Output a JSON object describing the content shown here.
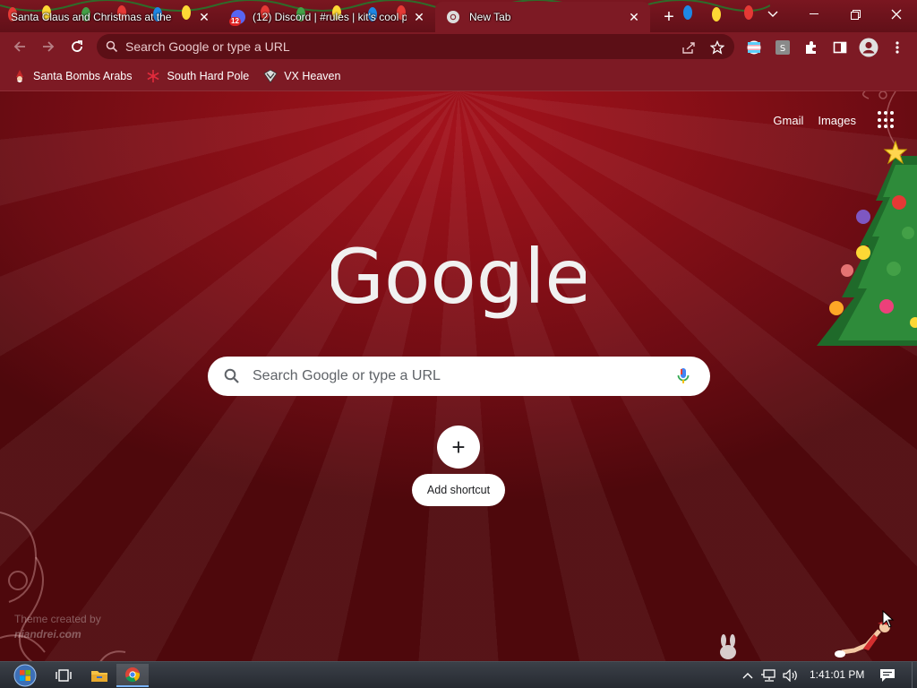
{
  "tabs": [
    {
      "title": "Santa Claus and Christmas at the",
      "active": false,
      "badge": ""
    },
    {
      "title": "(12) Discord | #rules | kit's cool p",
      "active": false,
      "badge": "12"
    },
    {
      "title": "New Tab",
      "active": true,
      "badge": ""
    }
  ],
  "window_controls": {
    "tab_search_icon": "chevron-down-icon",
    "minimize_icon": "minimize-icon",
    "restore_icon": "restore-icon",
    "close_icon": "close-icon"
  },
  "toolbar": {
    "omnibox_placeholder": "Search Google or type a URL",
    "icons": [
      "back-icon",
      "forward-icon",
      "reload-icon",
      "share-icon",
      "star-icon",
      "extensions-icon",
      "side-panel-icon",
      "profile-icon",
      "menu-icon"
    ]
  },
  "bookmarks": [
    {
      "label": "Santa Bombs Arabs",
      "icon": "santa-icon"
    },
    {
      "label": "South Hard Pole",
      "icon": "snowflake-icon"
    },
    {
      "label": "VX Heaven",
      "icon": "vx-icon"
    }
  ],
  "ntp": {
    "links": {
      "gmail": "Gmail",
      "images": "Images"
    },
    "logo_text": "Google",
    "search_placeholder": "Search Google or type a URL",
    "add_shortcut_label": "Add shortcut",
    "add_shortcut_symbol": "+",
    "theme_credit_line1": "Theme created by",
    "theme_credit_line2": "niandrei.com"
  },
  "taskbar": {
    "clock": "1:41:01 PM",
    "pinned": [
      "start-orb-icon",
      "task-view-icon",
      "file-explorer-icon",
      "chrome-icon"
    ]
  },
  "colors": {
    "frame": "#7d1a24",
    "tabstrip": "#611018",
    "ntp_background": "#8a0f17",
    "google_logo": "#f1f1f1",
    "taskbar": "#2e333a"
  }
}
